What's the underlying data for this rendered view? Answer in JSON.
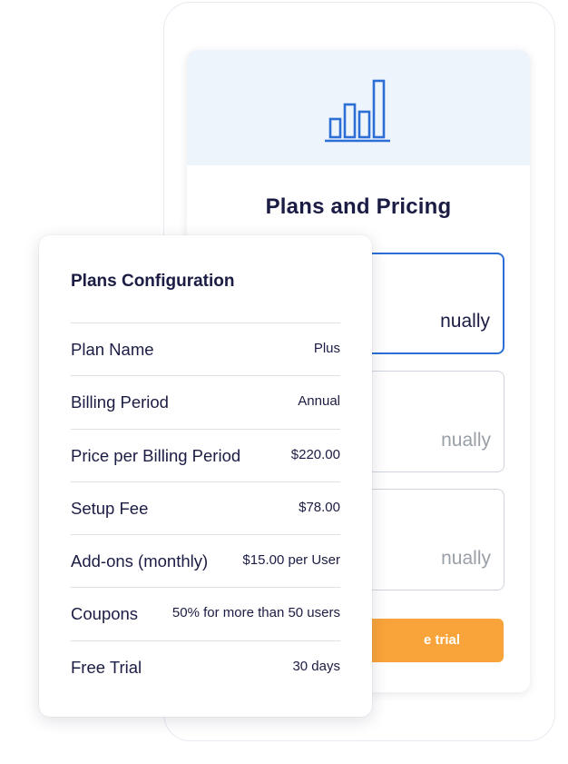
{
  "pricing_card": {
    "title": "Plans and Pricing",
    "options": [
      {
        "label": "nually",
        "selected": true
      },
      {
        "label": "nually",
        "selected": false
      },
      {
        "label": "nually",
        "selected": false
      }
    ],
    "trial_button_label": "e trial",
    "header_icon": "bar-chart-icon"
  },
  "config_card": {
    "title": "Plans Configuration",
    "rows": [
      {
        "label": "Plan Name",
        "value": "Plus"
      },
      {
        "label": "Billing Period",
        "value": "Annual"
      },
      {
        "label": "Price per Billing Period",
        "value": "$220.00"
      },
      {
        "label": "Setup Fee",
        "value": "$78.00"
      },
      {
        "label": "Add-ons (monthly)",
        "value": "$15.00 per User"
      },
      {
        "label": "Coupons",
        "value": "50% for more than 50 users"
      },
      {
        "label": "Free Trial",
        "value": "30 days"
      }
    ]
  },
  "colors": {
    "accent_blue": "#2b6fd6",
    "trial_orange": "#f9a43a",
    "heading_navy": "#1b1c43",
    "header_bg": "#eef4fc"
  }
}
